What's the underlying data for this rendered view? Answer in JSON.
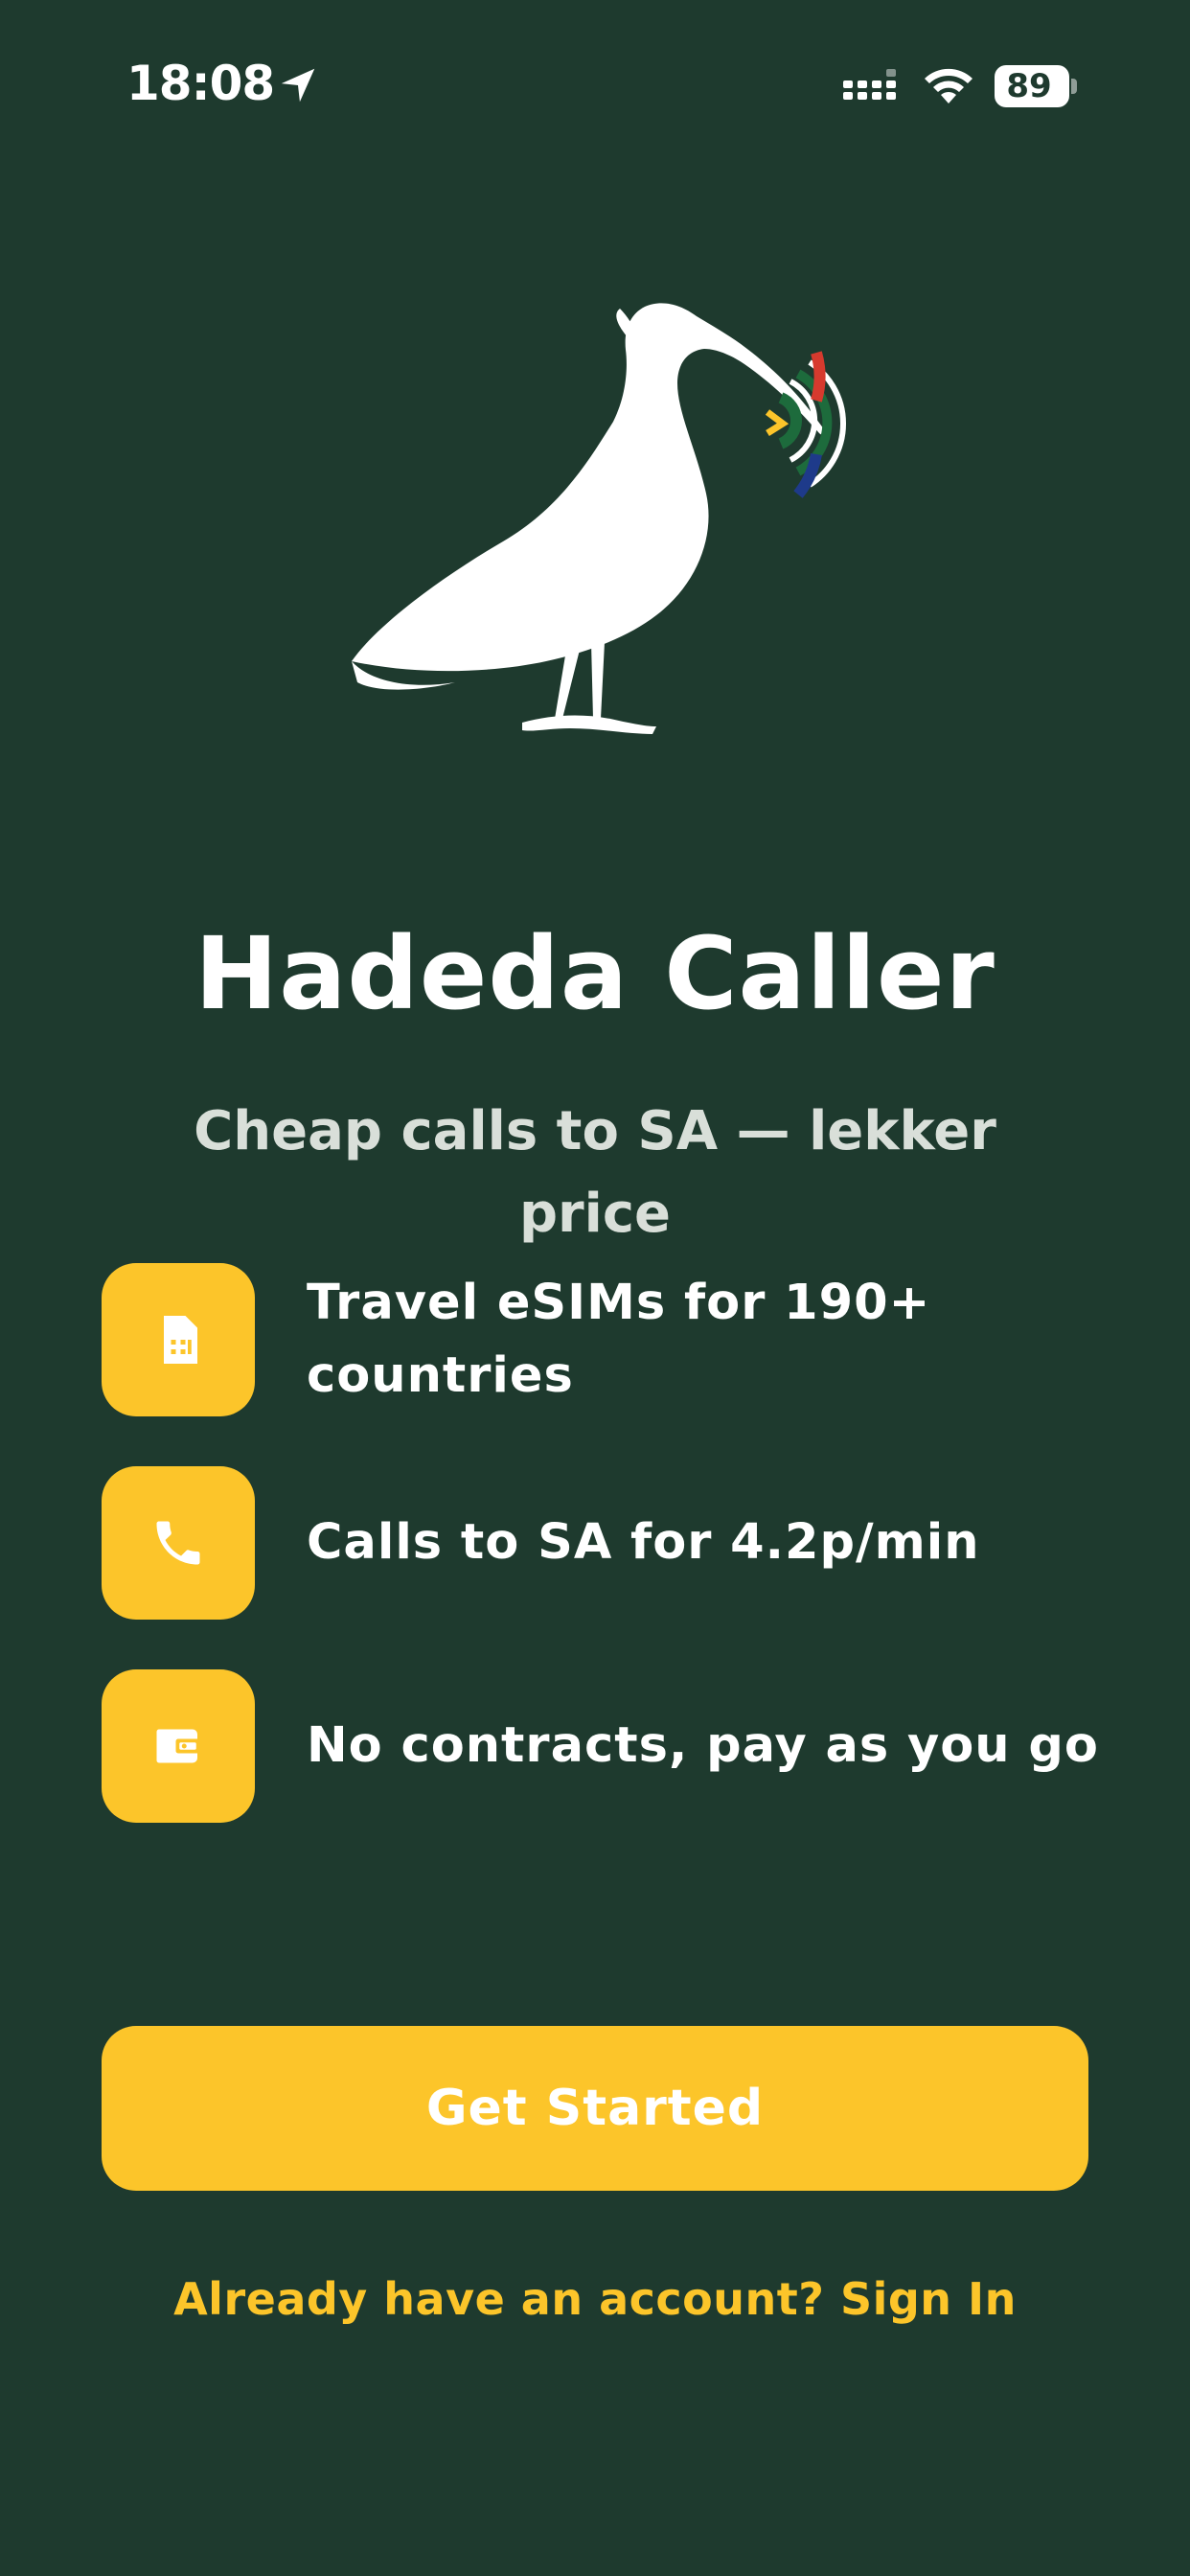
{
  "status_bar": {
    "time": "18:08",
    "battery_level": "89",
    "icons": [
      "location-arrow-icon",
      "cellular-signal-icon",
      "wifi-icon",
      "battery-icon"
    ]
  },
  "logo": {
    "icon": "hadeda-ibis-logo-with-sa-flag-signal-waves"
  },
  "app": {
    "title": "Hadeda Caller",
    "tagline": "Cheap calls to SA — lekker price"
  },
  "features": [
    {
      "icon": "sim-card-icon",
      "text": "Travel eSIMs for 190+ countries"
    },
    {
      "icon": "phone-icon",
      "text": "Calls to SA for 4.2p/min"
    },
    {
      "icon": "wallet-icon",
      "text": "No contracts, pay as you go"
    }
  ],
  "actions": {
    "get_started_label": "Get Started",
    "sign_in_label": "Already have an account? Sign In"
  },
  "colors": {
    "background": "#1e3a2e",
    "accent": "#fcc52a",
    "text": "#ffffff",
    "subtext": "#d9dfd9"
  }
}
